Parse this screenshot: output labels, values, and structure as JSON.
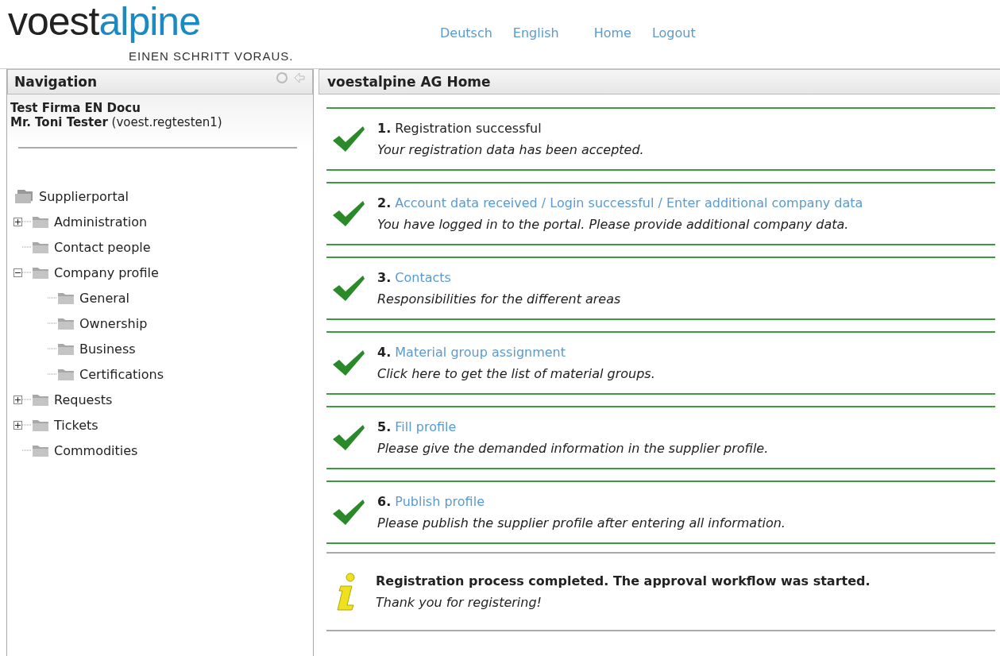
{
  "logo": {
    "part_1": "voest",
    "part_2": "alpine",
    "tagline": "EINEN SCHRITT VORAUS."
  },
  "top_links": [
    {
      "label": "Deutsch"
    },
    {
      "label": "English"
    },
    {
      "label": "Home"
    },
    {
      "label": "Logout"
    }
  ],
  "navigation": {
    "title": "Navigation",
    "company": "Test Firma EN Docu",
    "user_name": "Mr. Toni Tester",
    "user_id": "(voest.regtesten1)",
    "tree": {
      "label": "Supplierportal",
      "children": [
        {
          "label": "Administration",
          "expanded": false
        },
        {
          "label": "Contact people"
        },
        {
          "label": "Company profile",
          "expanded": true,
          "children": [
            {
              "label": "General"
            },
            {
              "label": "Ownership"
            },
            {
              "label": "Business"
            },
            {
              "label": "Certifications"
            }
          ]
        },
        {
          "label": "Requests",
          "expanded": false
        },
        {
          "label": "Tickets",
          "expanded": false
        },
        {
          "label": "Commodities"
        }
      ]
    }
  },
  "main": {
    "title": "voestalpine AG Home",
    "steps": [
      {
        "number": "1.",
        "title": "Registration successful",
        "kind": "text",
        "description": "Your registration data has been accepted."
      },
      {
        "number": "2.",
        "title": "Account data received / Login successful / Enter additional company data",
        "kind": "link",
        "description": "You have logged in to the portal. Please provide additional company data."
      },
      {
        "number": "3.",
        "title": "Contacts",
        "kind": "link",
        "description": "Responsibilities for the different areas"
      },
      {
        "number": "4.",
        "title": "Material group assignment",
        "kind": "link",
        "description": "Click here to get the list of material groups."
      },
      {
        "number": "5.",
        "title": "Fill profile",
        "kind": "link",
        "description": "Please give the demanded information in the supplier profile."
      },
      {
        "number": "6.",
        "title": "Publish profile",
        "kind": "link",
        "description": "Please publish the supplier profile after entering all information."
      }
    ],
    "notice": {
      "title": "Registration process completed. The approval workflow was started.",
      "text": "Thank you for registering!"
    }
  }
}
